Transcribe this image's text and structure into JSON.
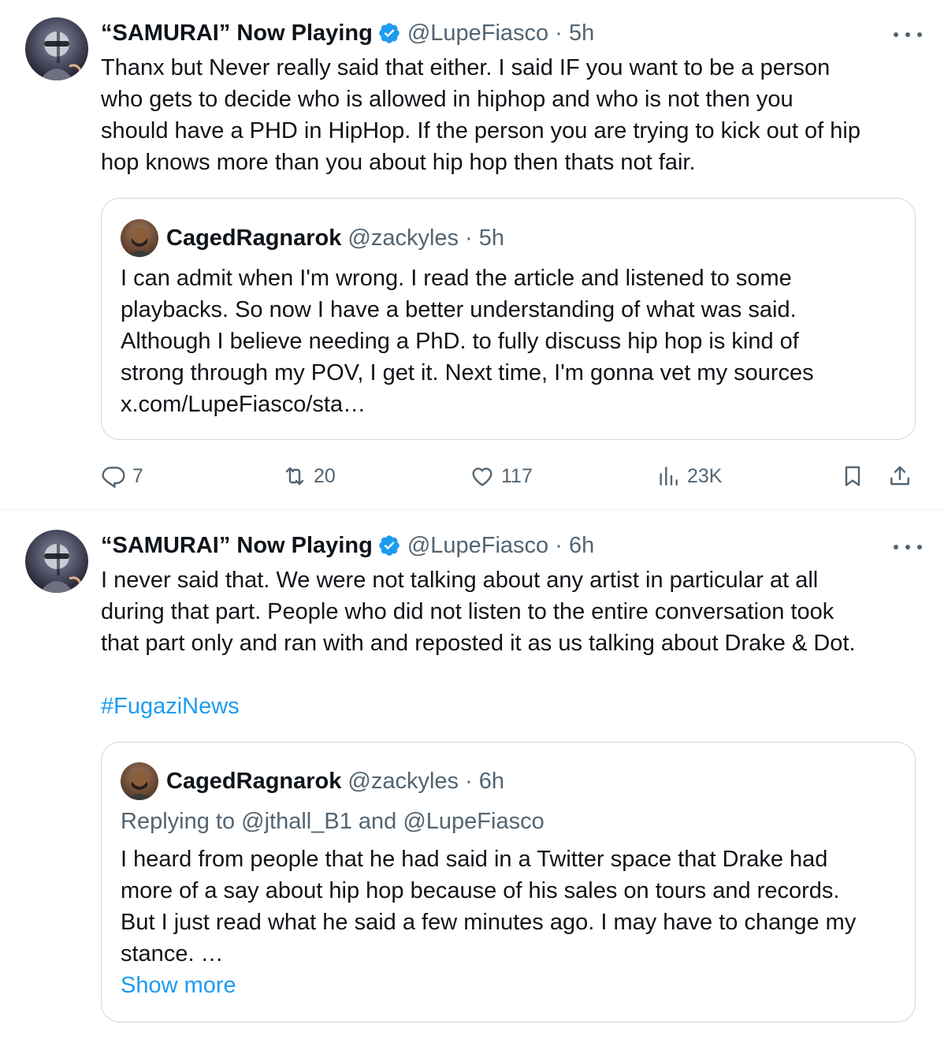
{
  "colors": {
    "link": "#1d9bf0",
    "muted": "#536471",
    "text": "#0f1419",
    "border": "#cfd9de",
    "verified": "#1d9bf0"
  },
  "tweets": [
    {
      "display_name": "“SAMURAI” Now Playing",
      "handle": "@LupeFiasco",
      "time": "5h",
      "handle_time": "@LupeFiasco · 5h",
      "text": "Thanx but Never really said that either. I said IF you want to be a person\nwho gets to decide who is allowed in hiphop and who is not then you\nshould have a PHD in HipHop. If the person you are trying to kick out of hip\nhop knows more than you about hip hop then thats not fair.",
      "quote": {
        "name": "CagedRagnarok",
        "handle_time": "@zackyles · 5h",
        "text": "I can admit when I'm wrong. I read the article and listened to some\nplaybacks. So now I have a better understanding of what was said.\nAlthough I believe needing a PhD. to fully discuss hip hop is kind of\nstrong through my POV, I get it. Next time, I'm  gonna vet my sources\nx.com/LupeFiasco/sta…"
      },
      "stats": {
        "replies": "7",
        "reposts": "20",
        "likes": "117",
        "views": "23K"
      }
    },
    {
      "display_name": "“SAMURAI” Now Playing",
      "handle": "@LupeFiasco",
      "time": "6h",
      "handle_time": "@LupeFiasco · 6h",
      "text": "I never said that. We were not talking about any artist in particular at all\nduring that part. People who did not listen to the entire conversation took\nthat part only and ran with and reposted it as us talking about Drake & Dot.",
      "hashtag": "#FugaziNews",
      "quote": {
        "name": "CagedRagnarok",
        "handle_time": "@zackyles · 6h",
        "reply_prefix": "Replying to ",
        "reply_user1": "@jthall_B1",
        "reply_and": " and ",
        "reply_user2": "@LupeFiasco",
        "text": "I heard from people that he had said in a Twitter space that Drake had\nmore of a say about hip hop because of his sales on tours and records.\nBut I just read what he said a few minutes ago. I may have to change my\nstance. …",
        "show_more": "Show more"
      }
    }
  ],
  "icons": [
    "more-icon",
    "verified-badge-icon",
    "reply-icon",
    "repost-icon",
    "like-icon",
    "views-icon",
    "bookmark-icon",
    "share-icon"
  ]
}
